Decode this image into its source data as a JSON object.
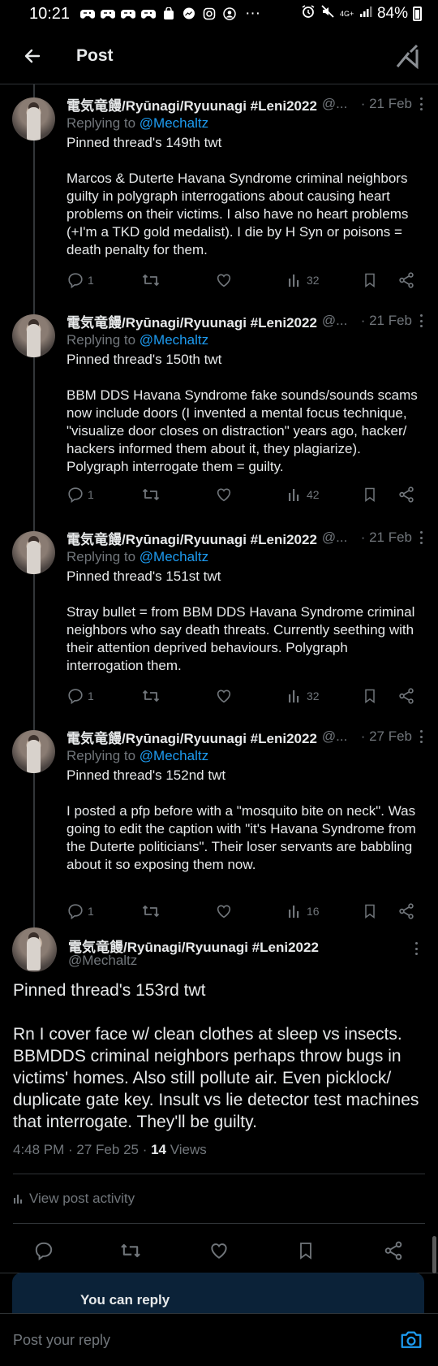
{
  "status": {
    "time": "10:21",
    "more": "···",
    "network": "4G+",
    "battery": "84%"
  },
  "header": {
    "title": "Post"
  },
  "tweets": [
    {
      "name": "電気竜饅/Ryūnagi/Ryuunagi #Leni2022",
      "handle": "@...",
      "date": "· 21 Feb",
      "replying_label": "Replying to",
      "replying_to": "@Mechaltz",
      "text": "Pinned thread's 149th twt\n\nMarcos & Duterte Havana Syndrome criminal neighbors guilty in polygraph interrogations about causing heart problems on their victims. I also have no heart problems (+I'm a TKD gold medalist). I die by H Syn or poisons = death penalty for them.",
      "replies": "1",
      "views": "32"
    },
    {
      "name": "電気竜饅/Ryūnagi/Ryuunagi #Leni2022",
      "handle": "@...",
      "date": "· 21 Feb",
      "replying_label": "Replying to",
      "replying_to": "@Mechaltz",
      "text": "Pinned thread's 150th twt\n\nBBM DDS Havana Syndrome fake sounds/sounds scams now include doors (I invented a mental focus technique, \"visualize door closes on distraction\" years ago, hacker/ hackers informed them about it, they plagiarize). Polygraph interrogate them = guilty.",
      "replies": "1",
      "views": "42"
    },
    {
      "name": "電気竜饅/Ryūnagi/Ryuunagi #Leni2022",
      "handle": "@...",
      "date": "· 21 Feb",
      "replying_label": "Replying to",
      "replying_to": "@Mechaltz",
      "text": "Pinned thread's 151st twt\n\nStray bullet = from BBM DDS Havana Syndrome criminal neighbors who say death threats. Currently seething with their attention deprived behaviours. Polygraph interrogation them.",
      "replies": "1",
      "views": "32"
    },
    {
      "name": "電気竜饅/Ryūnagi/Ryuunagi #Leni2022",
      "handle": "@...",
      "date": "· 27 Feb",
      "replying_label": "Replying to",
      "replying_to": "@Mechaltz",
      "text": "Pinned thread's 152nd twt\n\nI posted a pfp before with a \"mosquito bite on neck\". Was going to edit the caption with \"it's Havana Syndrome from the Duterte politicians\". Their loser servants are babbling about it so exposing them now.",
      "replies": "1",
      "views": "16"
    }
  ],
  "main": {
    "name": "電気竜饅/Ryūnagi/Ryuunagi #Leni2022",
    "handle": "@Mechaltz",
    "text": "Pinned thread's 153rd twt\n\nRn I cover face w/ clean clothes at sleep vs insects. BBMDDS criminal neighbors perhaps throw bugs in victims' homes. Also still pollute air. Even picklock/ duplicate gate key. Insult vs lie detector test machines that interrogate. They'll be guilty.",
    "time": "4:48 PM · 27 Feb 25 · ",
    "views_count": "14",
    "views_label": " Views",
    "activity": "View post activity"
  },
  "card": {
    "title": "You can reply"
  },
  "reply": {
    "placeholder": "Post your reply"
  },
  "colors": {
    "accent": "#1d9bf0",
    "muted": "#71767b",
    "bg": "#000000",
    "text": "#e7e9ea"
  }
}
